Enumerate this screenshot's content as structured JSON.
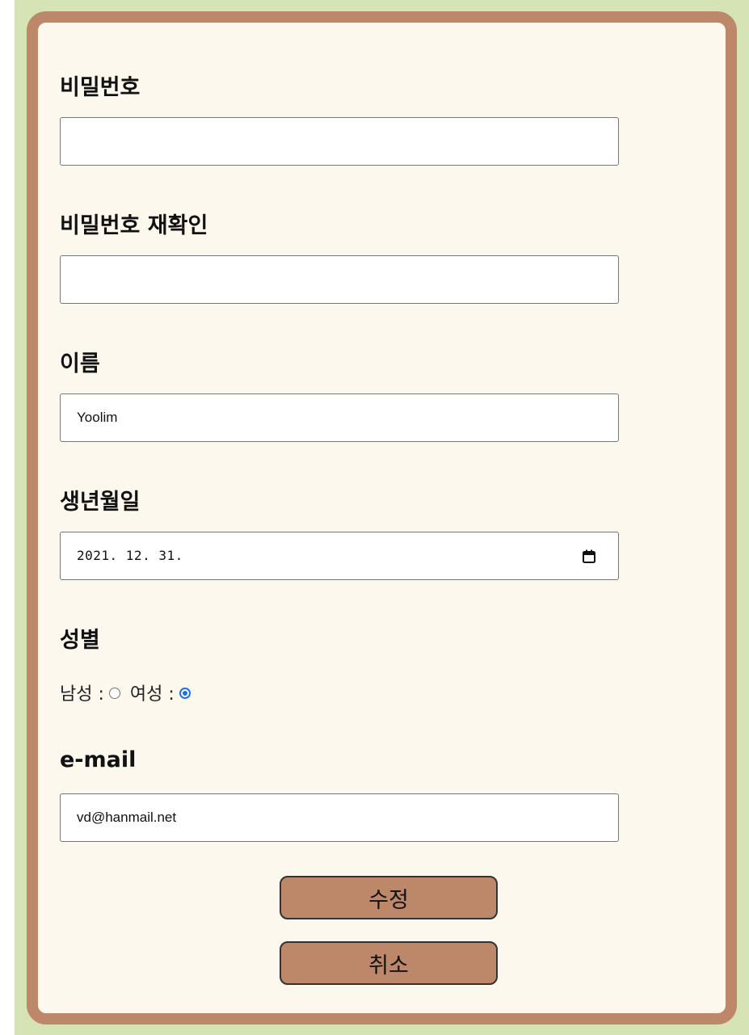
{
  "form": {
    "password": {
      "label": "비밀번호",
      "value": ""
    },
    "password_confirm": {
      "label": "비밀번호 재확인",
      "value": ""
    },
    "name": {
      "label": "이름",
      "value": "Yoolim"
    },
    "birthdate": {
      "label": "생년월일",
      "display": "2021. 12. 31.",
      "icon": "calendar-icon"
    },
    "gender": {
      "label": "성별",
      "options": [
        {
          "label": "남성 :",
          "checked": false
        },
        {
          "label": "여성 :",
          "checked": true
        }
      ]
    },
    "email": {
      "label": "e-mail",
      "value": "vd@hanmail.net"
    }
  },
  "buttons": {
    "submit_label": "수정",
    "cancel_label": "취소"
  },
  "colors": {
    "page_background": "#d5e3b5",
    "card_background": "#fdf8ee",
    "card_border": "#bd8869",
    "button_background": "#bd8869",
    "radio_accent": "#1a73e8"
  }
}
